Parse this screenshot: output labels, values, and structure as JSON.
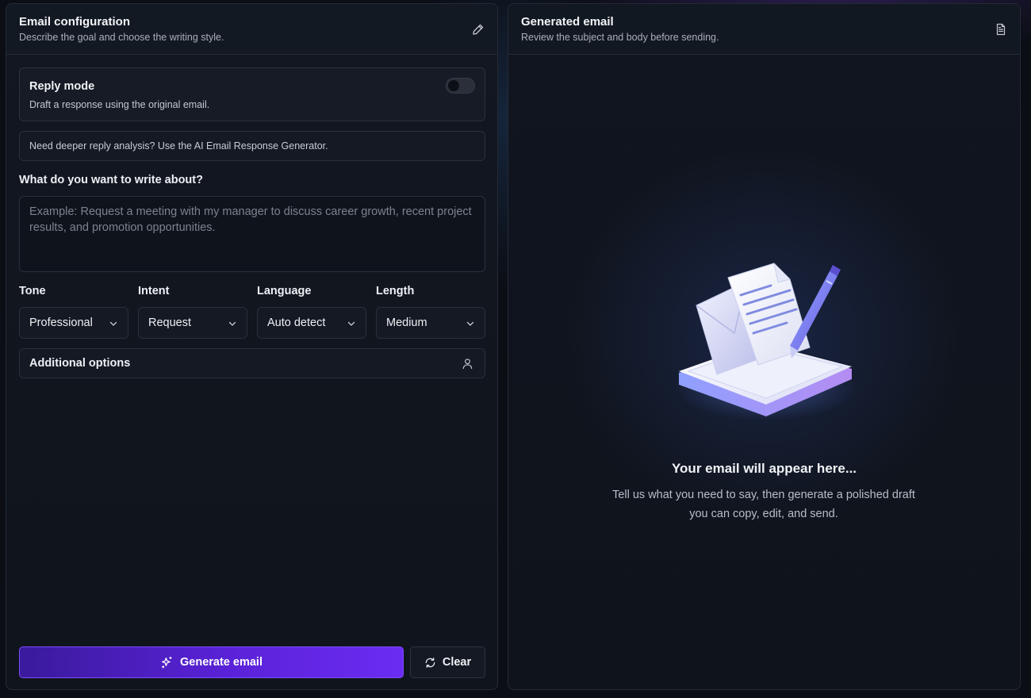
{
  "config": {
    "title": "Email configuration",
    "subtitle": "Describe the goal and choose the writing style.",
    "edit_icon": "pencil-icon",
    "reply": {
      "title": "Reply mode",
      "subtitle": "Draft a response using the original email.",
      "enabled": false
    },
    "note": "Need deeper reply analysis? Use the AI Email Response Generator.",
    "topic": {
      "label": "What do you want to write about?",
      "value": "",
      "placeholder": "Example: Request a meeting with my manager to discuss career growth, recent project results, and promotion opportunities."
    },
    "selects": [
      {
        "label": "Tone",
        "value": "Professional"
      },
      {
        "label": "Intent",
        "value": "Request"
      },
      {
        "label": "Language",
        "value": "Auto detect"
      },
      {
        "label": "Length",
        "value": "Medium"
      }
    ],
    "additional_options": "Additional options",
    "generate_label": "Generate email",
    "clear_label": "Clear"
  },
  "output": {
    "title": "Generated email",
    "subtitle": "Review the subject and body before sending.",
    "doc_icon": "document-icon",
    "empty_title": "Your email will appear here...",
    "empty_sub": "Tell us what you need to say, then generate a polished draft you can copy, edit, and send."
  },
  "colors": {
    "accent_start": "#3a1a9c",
    "accent_end": "#6b2cf2",
    "background": "#0b0e15",
    "panel": "#121721"
  }
}
